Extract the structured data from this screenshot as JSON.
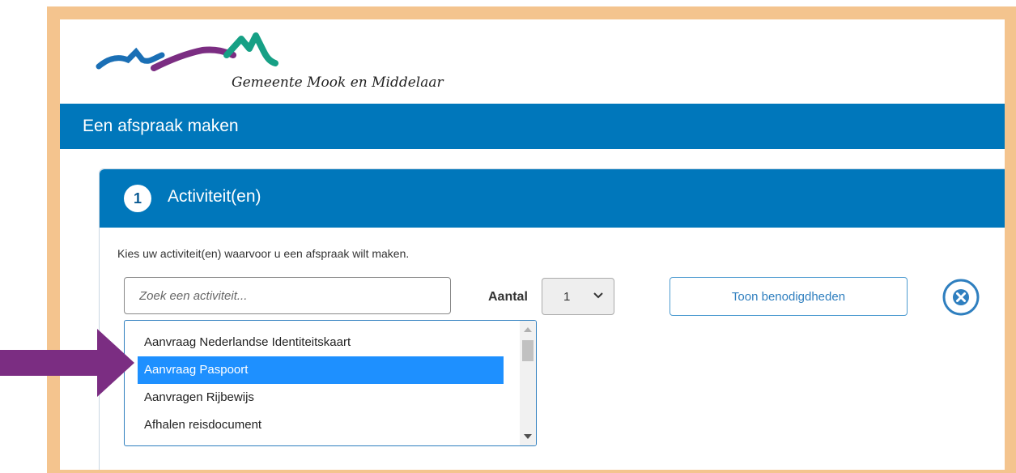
{
  "logo": {
    "text": "Gemeente Mook en Middelaar"
  },
  "header": {
    "title": "Een afspraak maken"
  },
  "step": {
    "number": "1",
    "title": "Activiteit(en)"
  },
  "form": {
    "instruction": "Kies uw activiteit(en) waarvoor u een afspraak wilt maken.",
    "search_placeholder": "Zoek een activiteit...",
    "search_value": "",
    "aantal_label": "Aantal",
    "aantal_value": "1",
    "toon_button": "Toon benodigdheden"
  },
  "dropdown": {
    "items": [
      {
        "label": "Aanvraag Nederlandse Identiteitskaart",
        "selected": false
      },
      {
        "label": "Aanvraag Paspoort",
        "selected": true
      },
      {
        "label": "Aanvragen Rijbewijs",
        "selected": false
      },
      {
        "label": "Afhalen reisdocument",
        "selected": false
      }
    ]
  },
  "colors": {
    "brand_blue": "#0077bb",
    "frame": "#f4c48e",
    "selection": "#1e90ff",
    "arrow": "#7b2d82",
    "logo_blue": "#1a6fb5",
    "logo_purple": "#7b2d82",
    "logo_green": "#16a085"
  },
  "icons": {
    "close": "close-circle-icon",
    "chevron": "chevron-down-icon",
    "arrow": "arrow-right-icon"
  }
}
